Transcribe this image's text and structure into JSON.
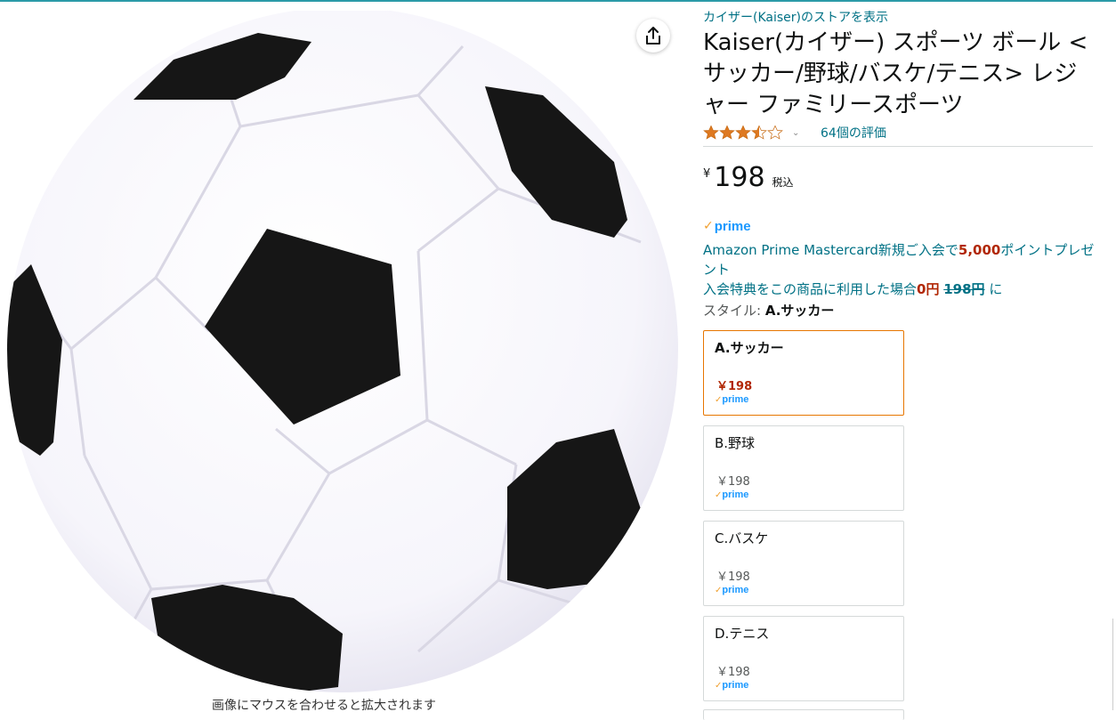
{
  "store_link": "カイザー(Kaiser)のストアを表示",
  "title": "Kaiser(カイザー) スポーツ ボール <サッカー/野球/バスケ/テニス> レジャー ファミリースポーツ",
  "rating": {
    "stars": 3.5,
    "count_text": "64個の評価"
  },
  "price": {
    "symbol": "¥",
    "whole": "198",
    "tax_label": "税込"
  },
  "prime_label": "prime",
  "promo": {
    "line1_a": "Amazon Prime Mastercard新規ご入会で",
    "line1_points": "5,000",
    "line1_b": "ポイントプレゼント",
    "line2_a": "入会特典をこの商品に利用した場合",
    "line2_price": "0円",
    "line2_strike": "198円",
    "line2_b": " に"
  },
  "style": {
    "label": "スタイル: ",
    "selected": "A.サッカー"
  },
  "swatches": [
    {
      "name": "A.サッカー",
      "price": "￥198",
      "prime": "prime"
    },
    {
      "name": "B.野球",
      "price": "￥198",
      "prime": "prime"
    },
    {
      "name": "C.バスケ",
      "price": "￥198",
      "prime": "prime"
    },
    {
      "name": "D.テニス",
      "price": "￥198",
      "prime": "prime"
    }
  ],
  "zoom_hint": "画像にマウスを合わせると拡大されます",
  "colors": {
    "link": "#007185",
    "price_red": "#b12704",
    "selected_border": "#e77600",
    "star": "#de7921"
  },
  "icons": {
    "share": "share-icon",
    "star": "star-icon",
    "chevron": "chevron-down-icon"
  }
}
